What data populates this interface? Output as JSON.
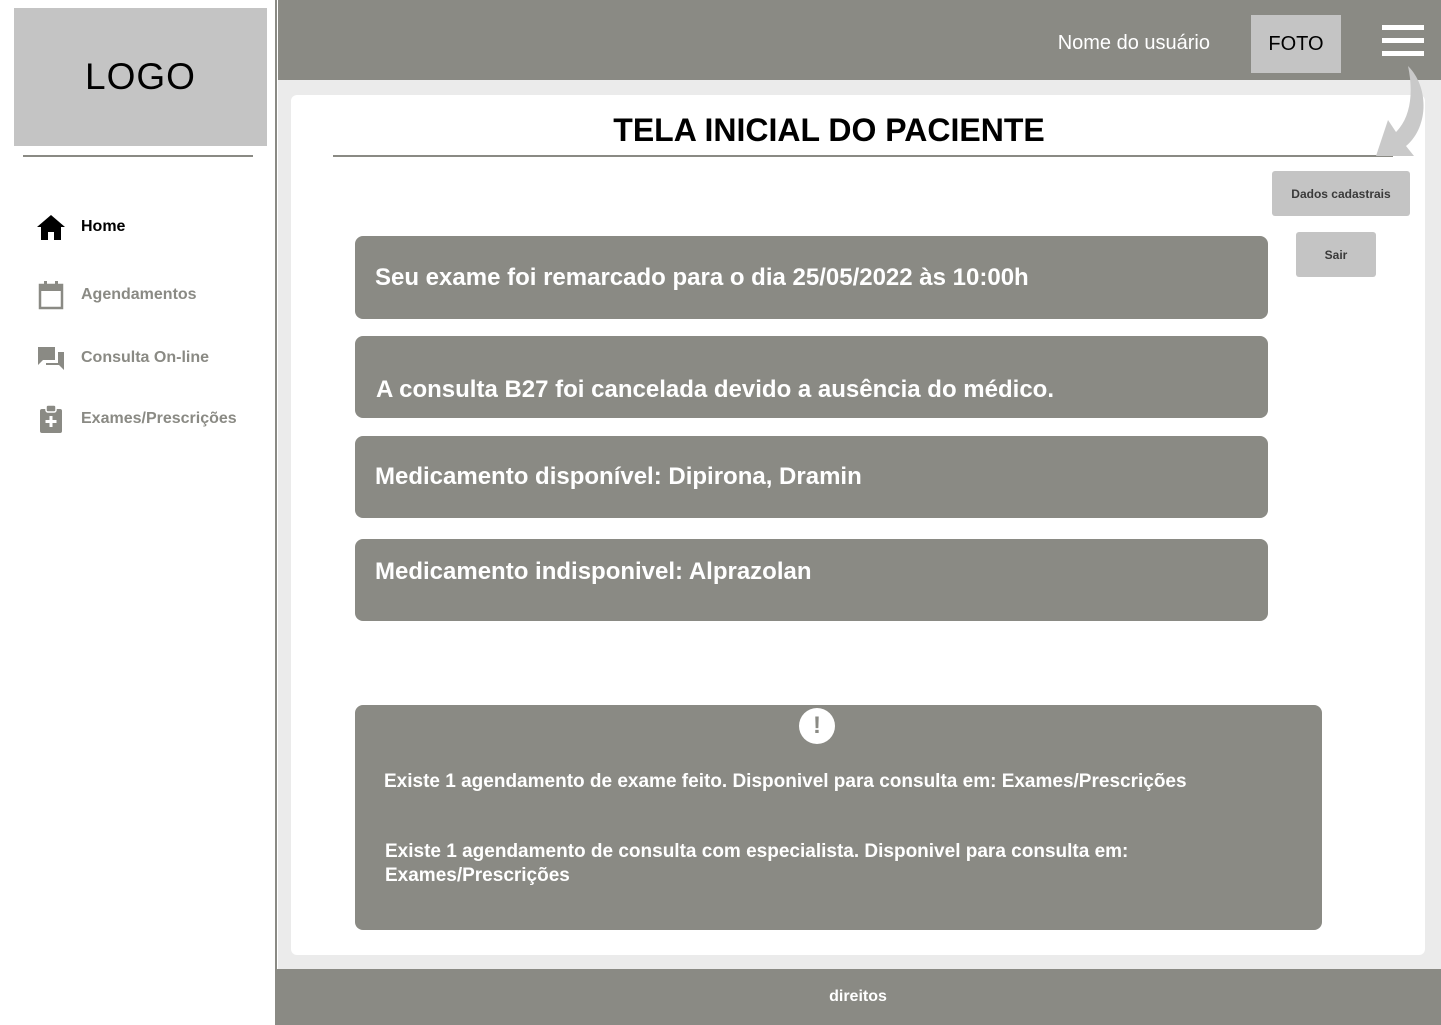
{
  "sidebar": {
    "logo": "LOGO",
    "items": [
      {
        "label": "Home",
        "icon": "home-icon",
        "active": true
      },
      {
        "label": "Agendamentos",
        "icon": "calendar-icon",
        "active": false
      },
      {
        "label": "Consulta On-line",
        "icon": "chat-icon",
        "active": false
      },
      {
        "label": "Exames/Prescrições",
        "icon": "medical-clipboard-icon",
        "active": false
      }
    ]
  },
  "header": {
    "username": "Nome do usuário",
    "photo_label": "FOTO",
    "menu_icon": "hamburger-menu-icon"
  },
  "main": {
    "title": "TELA INICIAL DO PACIENTE",
    "buttons": {
      "dados": "Dados cadastrais",
      "sair": "Sair"
    },
    "notices": [
      "Seu exame foi remarcado para o dia  25/05/2022 às 10:00h",
      "A consulta B27 foi cancelada devido a ausência do médico.",
      "Medicamento disponível: Dipirona, Dramin",
      "Medicamento indisponivel: Alprazolan"
    ],
    "alert": {
      "icon": "exclamation-icon",
      "lines": [
        "Existe 1 agendamento de exame feito. Disponivel  para consulta em: Exames/Prescrições",
        "Existe 1 agendamento de consulta com especialista. Disponivel  para consulta em: Exames/Prescrições"
      ]
    }
  },
  "footer": {
    "text": "direitos"
  },
  "colors": {
    "primary_gray": "#8a8a84",
    "light_gray": "#c4c4c4",
    "background": "#ebebeb"
  }
}
